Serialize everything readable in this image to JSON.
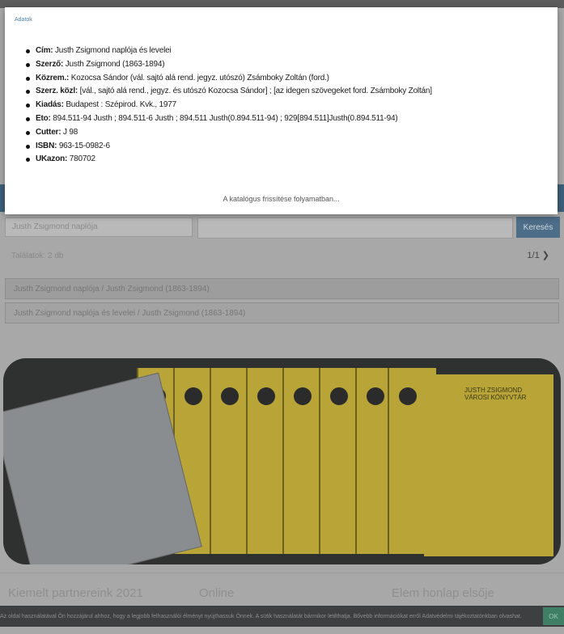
{
  "modal": {
    "title": "Adatok",
    "fields": [
      {
        "label": "Cím:",
        "value": " Justh Zsigmond naplója és levelei"
      },
      {
        "label": "Szerző:",
        "value": " Justh Zsigmond (1863-1894)"
      },
      {
        "label": "Közrem.:",
        "value": " Kozocsa Sándor (vál. sajtó alá rend. jegyz. utószó)  Zsámboky Zoltán (ford.)"
      },
      {
        "label": "Szerz. közl:",
        "value": " [vál., sajtó alá rend., jegyz. és utószó Kozocsa Sándor] ; [az idegen szövegeket ford. Zsámboky Zoltán]"
      },
      {
        "label": "Kiadás:",
        "value": " Budapest : Szépirod. Kvk., 1977"
      },
      {
        "label": "Eto:",
        "value": " 894.511-94 Justh ; 894.511-6 Justh ; 894.511 Justh(0.894.511-94) ; 929[894.511]Justh(0.894.511-94)"
      },
      {
        "label": "Cutter:",
        "value": " J 98"
      },
      {
        "label": "ISBN:",
        "value": " 963-15-0982-6"
      },
      {
        "label": "UKazon:",
        "value": " 780702"
      }
    ],
    "footer_link": "A katalógus frissítése folyamatban..."
  },
  "background": {
    "search_placeholder": "Justh Zsigmond naplója",
    "search_button": "Keresés",
    "result_info": "Találatok: 2 db",
    "pager": "1/1 ❯",
    "results": [
      "Justh Zsigmond naplója / Justh Zsigmond (1863-1894)",
      "Justh Zsigmond naplója és levelei / Justh Zsigmond (1863-1894)"
    ],
    "banner_cover_title": "JUSTH ZSIGMOND VÁROSI KÖNYVTÁR",
    "footer_cols": [
      "Kiemelt partnereink 2021",
      "Online",
      "Elem honlap elsője"
    ],
    "cookie_text": "Az oldal használatával Ön hozzájárul ahhoz, hogy a legjobb felhasználói élményt nyújthassuk Önnek. A sütik használatát bármikor letilthatja. Bővebb információkat erről Adatvédelmi tájékoztatónkban olvashat.",
    "cookie_button": "OK"
  }
}
